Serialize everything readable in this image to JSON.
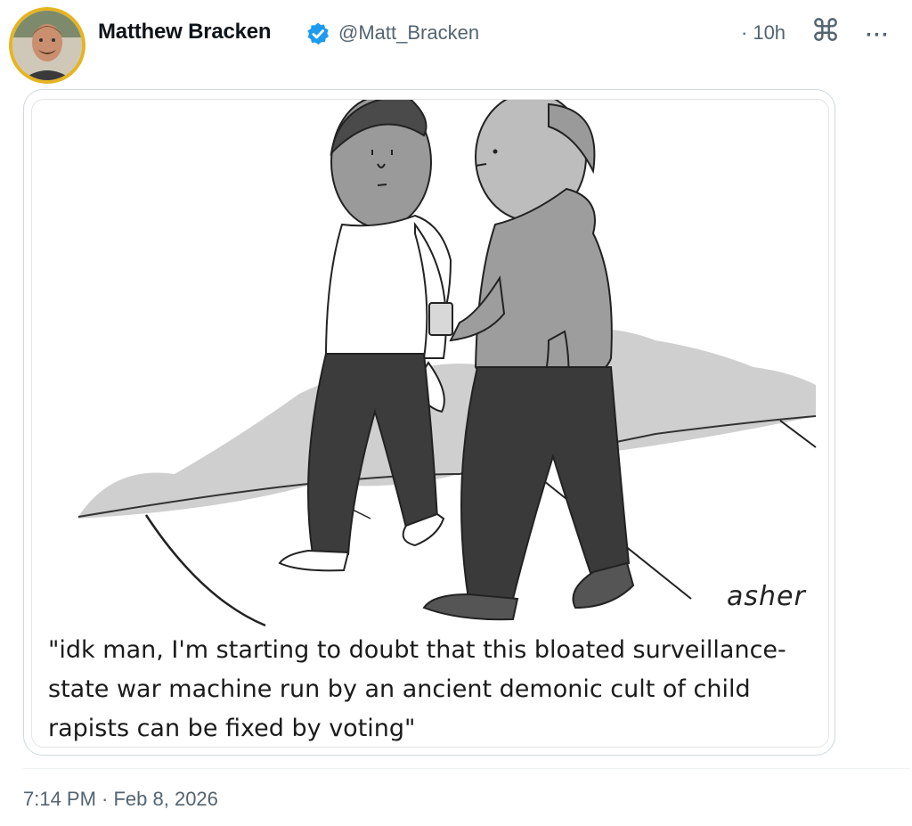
{
  "author": {
    "name": "Matthew Bracken",
    "handle": "@Matt_Bracken",
    "verified": true,
    "avatar_ring_color": "#e6b422"
  },
  "post": {
    "relative_time": "10h",
    "time_separator": "·",
    "timestamp": "7:14 PM · Feb 8, 2026"
  },
  "header_icons": {
    "command": "⌘",
    "more": "···"
  },
  "cartoon": {
    "signature": "asher",
    "caption": "\"idk man, I'm starting to doubt that this bloated surveillance-state war machine run by an ancient demonic cult of child rapists can be fixed by voting\""
  },
  "colors": {
    "verified_badge": "#1d9bf0",
    "secondary_text": "#536471"
  }
}
